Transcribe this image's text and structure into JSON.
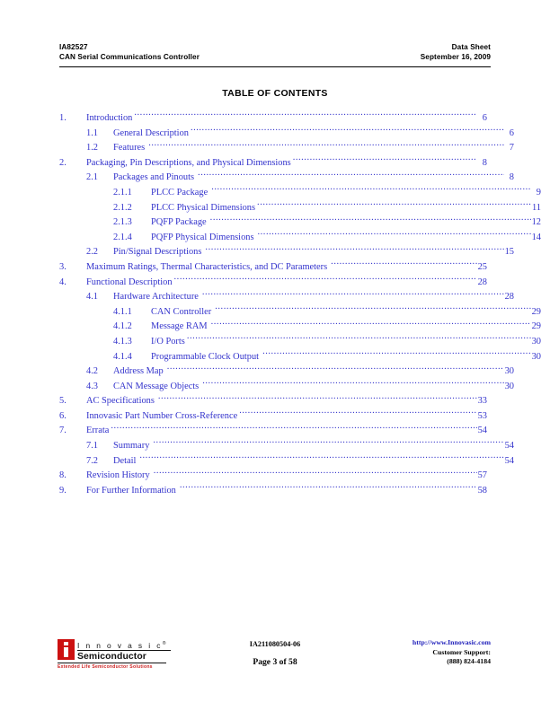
{
  "header": {
    "part_number": "IA82527",
    "doc_type": "Data Sheet",
    "product_name": "CAN Serial Communications Controller",
    "date": "September 16, 2009"
  },
  "title": "TABLE OF CONTENTS",
  "colors": {
    "toc_link": "#3333CC",
    "logo_red": "#CC1111",
    "tagline_red": "#CC2222",
    "url_blue": "#2222BB"
  },
  "toc": {
    "entries": [
      {
        "level": 1,
        "number": "1.",
        "label": "Introduction",
        "page": "6",
        "gap": false
      },
      {
        "level": 2,
        "number": "1.1",
        "label": "General Description",
        "page": "6",
        "gap": false
      },
      {
        "level": 2,
        "number": "1.2",
        "label": "Features",
        "page": "7",
        "gap": true
      },
      {
        "level": 1,
        "number": "2.",
        "label": "Packaging, Pin Descriptions, and Physical Dimensions",
        "page": "8",
        "gap": false
      },
      {
        "level": 2,
        "number": "2.1",
        "label": "Packages and Pinouts",
        "page": "8",
        "gap": true
      },
      {
        "level": 3,
        "number": "2.1.1",
        "label": "PLCC Package",
        "page": "9",
        "gap": true
      },
      {
        "level": 3,
        "number": "2.1.2",
        "label": "PLCC Physical Dimensions",
        "page": "11",
        "gap": false
      },
      {
        "level": 3,
        "number": "2.1.3",
        "label": "PQFP Package",
        "page": "12",
        "gap": true
      },
      {
        "level": 3,
        "number": "2.1.4",
        "label": "PQFP Physical Dimensions",
        "page": "14",
        "gap": true
      },
      {
        "level": 2,
        "number": "2.2",
        "label": "Pin/Signal Descriptions",
        "page": "15",
        "gap": true
      },
      {
        "level": 1,
        "number": "3.",
        "label": "Maximum Ratings, Thermal Characteristics, and DC Parameters",
        "page": "25",
        "gap": true
      },
      {
        "level": 1,
        "number": "4.",
        "label": "Functional Description",
        "page": "28",
        "gap": false
      },
      {
        "level": 2,
        "number": "4.1",
        "label": "Hardware Architecture",
        "page": "28",
        "gap": true
      },
      {
        "level": 3,
        "number": "4.1.1",
        "label": "CAN Controller",
        "page": "29",
        "gap": true
      },
      {
        "level": 3,
        "number": "4.1.2",
        "label": "Message RAM",
        "page": "29",
        "gap": true
      },
      {
        "level": 3,
        "number": "4.1.3",
        "label": "I/O Ports",
        "page": "30",
        "gap": false
      },
      {
        "level": 3,
        "number": "4.1.4",
        "label": "Programmable Clock Output",
        "page": "30",
        "gap": true
      },
      {
        "level": 2,
        "number": "4.2",
        "label": "Address Map",
        "page": "30",
        "gap": true
      },
      {
        "level": 2,
        "number": "4.3",
        "label": "CAN Message Objects",
        "page": "30",
        "gap": true
      },
      {
        "level": 1,
        "number": "5.",
        "label": "AC Specifications",
        "page": "33",
        "gap": true
      },
      {
        "level": 1,
        "number": "6.",
        "label": "Innovasic Part Number Cross-Reference",
        "page": "53",
        "gap": false
      },
      {
        "level": 1,
        "number": "7.",
        "label": "Errata",
        "page": "54",
        "gap": false
      },
      {
        "level": 2,
        "number": "7.1",
        "label": "Summary",
        "page": "54",
        "gap": true
      },
      {
        "level": 2,
        "number": "7.2",
        "label": "Detail",
        "page": "54",
        "gap": true
      },
      {
        "level": 1,
        "number": "8.",
        "label": "Revision History",
        "page": "57",
        "gap": true
      },
      {
        "level": 1,
        "number": "9.",
        "label": "For Further Information",
        "page": "58",
        "gap": true
      }
    ]
  },
  "footer": {
    "logo": {
      "wordmark_top": "I n n o v a s i c",
      "wordmark_top_mark": "®",
      "wordmark_bottom": "Semiconductor",
      "tagline": "Extended Life Semiconductor Solutions"
    },
    "doc_id": "IA211080504-06",
    "page_label": "Page 3 of 58",
    "url": "http://www.Innovasic.com",
    "support_label": "Customer Support:",
    "support_phone": "(888) 824-4184"
  }
}
